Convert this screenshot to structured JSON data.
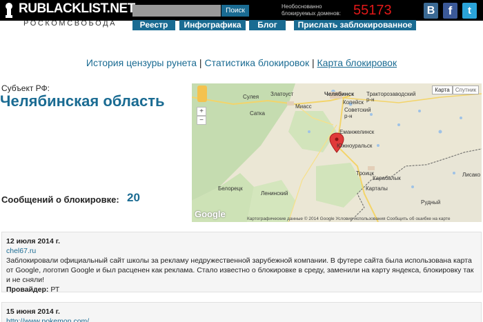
{
  "header": {
    "logo_text": "RUBLACKLIST.NET",
    "subtitle": "РОСКОМСВОБОДА",
    "search_placeholder": "",
    "search_button": "Поиск",
    "counter_label": "Необоснованно блокируемых доменов:",
    "counter_value": "55173",
    "social": {
      "vk": "B",
      "fb": "f",
      "tw": "t"
    }
  },
  "nav": {
    "items": [
      "Реестр",
      "Инфографика",
      "Блог",
      "Прислать заблокированное"
    ]
  },
  "links": {
    "item1": "История цензуры рунета",
    "sep": "|",
    "item2": "Статистика блокировок",
    "item3": "Карта блокировок"
  },
  "region": {
    "label": "Субъект РФ:",
    "name": "Челябинская область",
    "messages_label": "Сообщений о блокировке:",
    "messages_count": "20"
  },
  "map": {
    "type_map": "Карта",
    "type_sat": "Спутник",
    "zoom_in": "+",
    "zoom_out": "−",
    "google": "Google",
    "attribution": "Картографические данные © 2014 Google    Условия использования    Сообщить об ошибке на карте",
    "cities": {
      "sulea": "Сулея",
      "zlatoust": "Златоуст",
      "chelyabinsk": "Челябинск",
      "traktoro": "Тракторозаводский",
      "r_n1": "р-н",
      "satka": "Сатка",
      "miass": "Миасс",
      "kopeysk": "Копейск",
      "sovetsky": "Советский",
      "r_n2": "р-н",
      "emanzhelinsk": "Еманжелинск",
      "yuzhnouralsk": "Южноуральск",
      "troitsk": "Троицк",
      "beloretsk": "Белорецк",
      "kartaly": "Карталы",
      "karabalyk": "Карабалык",
      "leninsky": "Ленинский",
      "rudny": "Рудный",
      "lisako": "Лисако"
    }
  },
  "posts": [
    {
      "date": "12 июля 2014 г.",
      "url": "chel67.ru",
      "text": "Заблокировали официальный сайт школы за рекламу недружественной зарубежной компании. В футере сайта была использована карта от Google, логотип Google и был расценен как реклама. Стало известно о блокировке в среду, заменили на карту яндекса, блокировку так и не сняли!",
      "provider_label": "Провайдер:",
      "provider": "РТ"
    },
    {
      "date": "15 июня 2014 г.",
      "url": "http://www.pokemon.com/"
    }
  ]
}
